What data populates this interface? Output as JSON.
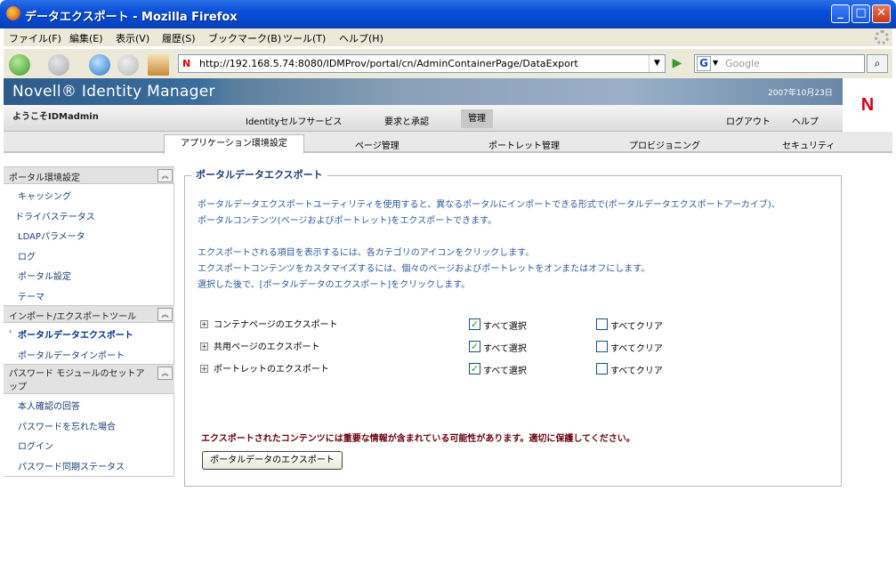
{
  "window": {
    "title": "データエクスポート - Mozilla Firefox"
  },
  "menu": [
    "ファイル(F)",
    "編集(E)",
    "表示(V)",
    "履歴(S)",
    "ブックマーク(B)",
    "ツール(T)",
    "ヘルプ(H)"
  ],
  "nav": {
    "url": "http://192.168.5.74:8080/IDMProv/portal/cn/AdminContainerPage/DataExport",
    "search_placeholder": "Google"
  },
  "header": {
    "brand": "Novell® Identity Manager",
    "date": "2007年10月23日",
    "welcome": "ようこそIDMadmin",
    "tabs": [
      "Identityセルフサービス",
      "要求と承認",
      "管理"
    ],
    "logout": "ログアウト",
    "help": "ヘルプ"
  },
  "subtabs": [
    "アプリケーション環境設定",
    "ページ管理",
    "ポートレット管理",
    "プロビジョニング",
    "セキュリティ"
  ],
  "sidebar": {
    "sections": [
      {
        "title": "ポータル環境設定",
        "items": [
          "キャッシング",
          "ドライバステータス",
          "LDAPパラメータ",
          "ログ",
          "ポータル設定",
          "テーマ"
        ]
      },
      {
        "title": "インポート/エクスポートツール",
        "items": [
          "ポータルデータエクスポート",
          "ポータルデータインポート"
        ]
      },
      {
        "title": "パスワード モジュールのセットアップ",
        "items": [
          "本人確認の回答",
          "パスワードを忘れた場合",
          "ログイン",
          "パスワード同期ステータス"
        ]
      }
    ]
  },
  "main": {
    "title": "ポータルデータエクスポート",
    "desc1": "ポータルデータエクスポートユーティリティを使用すると、異なるポータルにインポートできる形式で(ポータルデータエクスポートアーカイブ)、",
    "desc2": "ポータルコンテンツ(ページおよびポートレット)をエクスポートできます。",
    "desc3": "エクスポートされる項目を表示するには、各カテゴリのアイコンをクリックします。",
    "desc4": "エクスポートコンテンツをカスタマイズするには、個々のページおよびポートレットをオンまたはオフにします。",
    "desc5": "選択した後で、[ポータルデータのエクスポート]をクリックします。",
    "rows": [
      {
        "label": "コンテナページのエクスポート",
        "select_all": "すべて選択",
        "clear_all": "すべてクリア"
      },
      {
        "label": "共用ページのエクスポート",
        "select_all": "すべて選択",
        "clear_all": "すべてクリア"
      },
      {
        "label": "ポートレットのエクスポート",
        "select_all": "すべて選択",
        "clear_all": "すべてクリア"
      }
    ],
    "warning": "エクスポートされたコンテンツには重要な情報が含まれている可能性があります。適切に保護してください。",
    "export_button": "ポータルデータのエクスポート"
  }
}
